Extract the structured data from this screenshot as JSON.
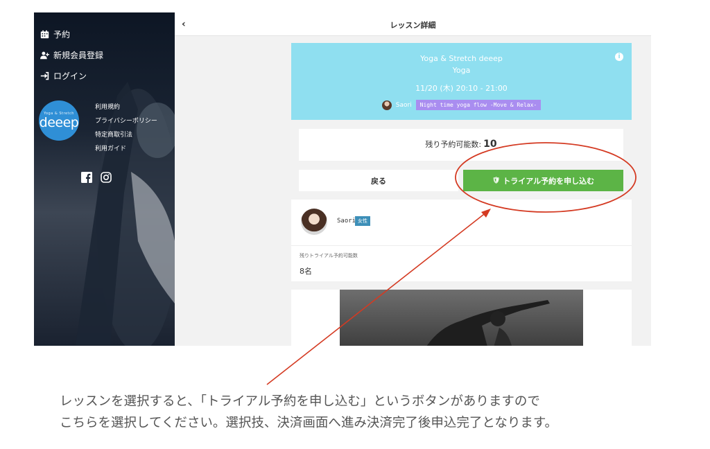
{
  "sidebar": {
    "nav": [
      {
        "label": "予約",
        "icon": "calendar-icon"
      },
      {
        "label": "新規会員登録",
        "icon": "user-plus-icon"
      },
      {
        "label": "ログイン",
        "icon": "sign-in-icon"
      }
    ],
    "logo": {
      "tagline": "Yoga & Stretch",
      "word": "deeep"
    },
    "links": [
      "利用規約",
      "プライバシーポリシー",
      "特定商取引法",
      "利用ガイド"
    ],
    "social": [
      "facebook-icon",
      "instagram-icon"
    ]
  },
  "header": {
    "back": "‹",
    "title": "レッスン詳細"
  },
  "lesson": {
    "studio": "Yoga & Stretch deeep",
    "category": "Yoga",
    "datetime": "11/20 (木) 20:10 - 21:00",
    "instructor": "Saori",
    "program": "Night time yoga flow -Move & Relax-",
    "banner_color": "#8fdff0"
  },
  "availability": {
    "label": "残り予約可能数:",
    "count": "10"
  },
  "buttons": {
    "back": "戻る",
    "trial": "トライアル予約を申し込む",
    "trial_color": "#5cb446"
  },
  "instructor_card": {
    "name": "Saori",
    "gender": "女性",
    "trial_label": "残りトライアル予約可能数",
    "trial_value": "8名"
  },
  "annotation": {
    "caption_line1": "レッスンを選択すると、「トライアル予約を申し込む」というボタンがありますので",
    "caption_line2": "こちらを選択してください。選択技、決済画面へ進み決済完了後申込完了となります。",
    "highlight_color": "#d43a22"
  }
}
